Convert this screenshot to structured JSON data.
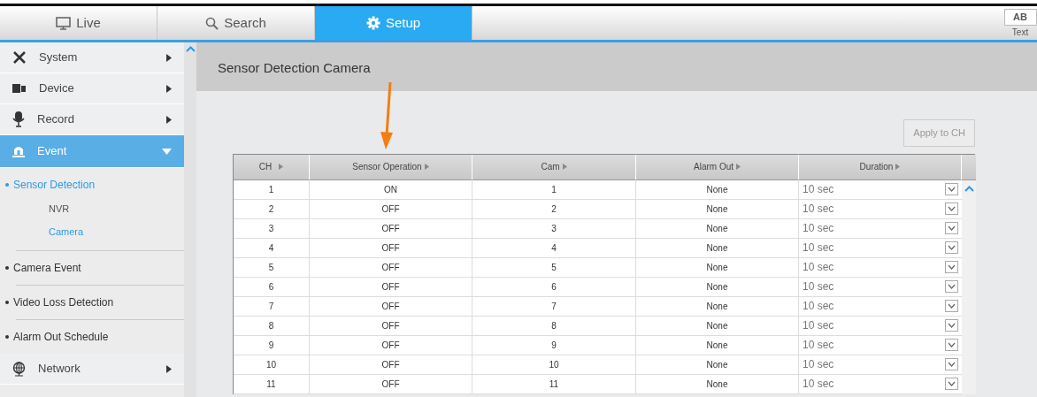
{
  "tabs": [
    {
      "label": "Live",
      "selected": false
    },
    {
      "label": "Search",
      "selected": false
    },
    {
      "label": "Setup",
      "selected": true
    }
  ],
  "text_toggle": {
    "button": "AB",
    "caption": "Text"
  },
  "sidebar": {
    "items": [
      {
        "label": "System",
        "expanded": false,
        "selected": false
      },
      {
        "label": "Device",
        "expanded": false,
        "selected": false
      },
      {
        "label": "Record",
        "expanded": false,
        "selected": false
      },
      {
        "label": "Event",
        "expanded": true,
        "selected": true,
        "children": [
          {
            "label": "Sensor Detection",
            "selected": true,
            "children": [
              {
                "label": "NVR",
                "selected": false
              },
              {
                "label": "Camera",
                "selected": true
              }
            ]
          },
          {
            "label": "Camera Event",
            "selected": false
          },
          {
            "label": "Video Loss Detection",
            "selected": false
          },
          {
            "label": "Alarm Out Schedule",
            "selected": false
          }
        ]
      },
      {
        "label": "Network",
        "expanded": false,
        "selected": false
      }
    ]
  },
  "page_title": "Sensor Detection Camera",
  "apply_button": {
    "label": "Apply to CH",
    "disabled": true
  },
  "table": {
    "columns": [
      "CH",
      "Sensor Operation",
      "Cam",
      "Alarm Out",
      "Duration"
    ],
    "rows": [
      {
        "ch": "1",
        "sensor_operation": "ON",
        "cam": "1",
        "alarm_out": "None",
        "duration": "10 sec"
      },
      {
        "ch": "2",
        "sensor_operation": "OFF",
        "cam": "2",
        "alarm_out": "None",
        "duration": "10 sec"
      },
      {
        "ch": "3",
        "sensor_operation": "OFF",
        "cam": "3",
        "alarm_out": "None",
        "duration": "10 sec"
      },
      {
        "ch": "4",
        "sensor_operation": "OFF",
        "cam": "4",
        "alarm_out": "None",
        "duration": "10 sec"
      },
      {
        "ch": "5",
        "sensor_operation": "OFF",
        "cam": "5",
        "alarm_out": "None",
        "duration": "10 sec"
      },
      {
        "ch": "6",
        "sensor_operation": "OFF",
        "cam": "6",
        "alarm_out": "None",
        "duration": "10 sec"
      },
      {
        "ch": "7",
        "sensor_operation": "OFF",
        "cam": "7",
        "alarm_out": "None",
        "duration": "10 sec"
      },
      {
        "ch": "8",
        "sensor_operation": "OFF",
        "cam": "8",
        "alarm_out": "None",
        "duration": "10 sec"
      },
      {
        "ch": "9",
        "sensor_operation": "OFF",
        "cam": "9",
        "alarm_out": "None",
        "duration": "10 sec"
      },
      {
        "ch": "10",
        "sensor_operation": "OFF",
        "cam": "10",
        "alarm_out": "None",
        "duration": "10 sec"
      },
      {
        "ch": "11",
        "sensor_operation": "OFF",
        "cam": "11",
        "alarm_out": "None",
        "duration": "10 sec"
      }
    ]
  }
}
